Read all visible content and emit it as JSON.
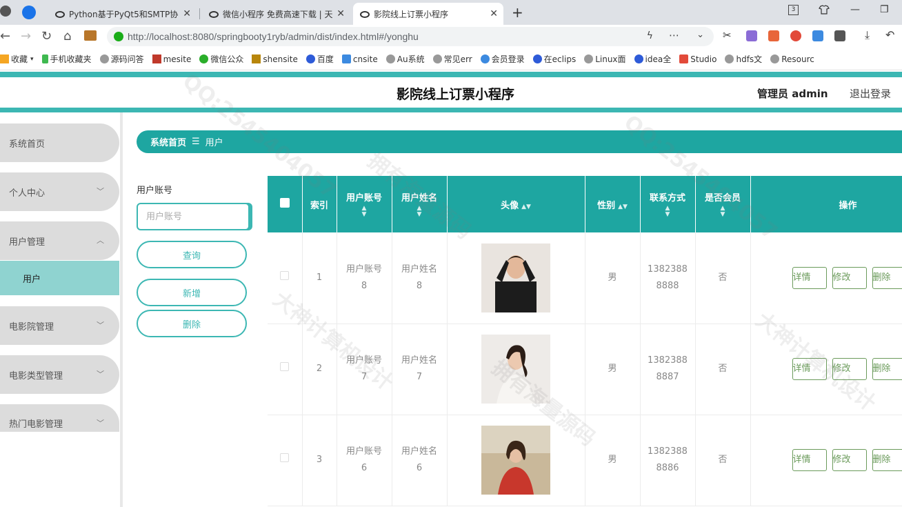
{
  "browser": {
    "tabs": [
      {
        "title": "Python基于PyQt5和SMTP协",
        "active": false
      },
      {
        "title": "微信小程序 免费高速下载 | 天",
        "active": false
      },
      {
        "title": "影院线上订票小程序",
        "active": true
      }
    ],
    "url": "http://localhost:8080/springbooty1ryb/admin/dist/index.html#/yonghu",
    "tab_count_badge": "3",
    "bookmarks": [
      "收藏",
      "手机收藏夹",
      "源码问答",
      "mesite",
      "微信公众",
      "shensite",
      "百度",
      "cnsite",
      "Au系统",
      "常见err",
      "会员登录",
      "在eclips",
      "Linux面",
      "idea全",
      "Studio",
      "hdfs文",
      "Resourc"
    ]
  },
  "header": {
    "title": "影院线上订票小程序",
    "admin": "管理员 admin",
    "logout": "退出登录"
  },
  "sidebar": {
    "items": [
      {
        "label": "系统首页",
        "chevron": false
      },
      {
        "label": "个人中心",
        "chevron": true
      },
      {
        "label": "用户管理",
        "chevron": true,
        "expanded": true
      },
      {
        "label": "电影院管理",
        "chevron": true
      },
      {
        "label": "电影类型管理",
        "chevron": true
      },
      {
        "label": "热门电影管理",
        "chevron": true
      }
    ],
    "sub_items": [
      {
        "label": "用户"
      }
    ]
  },
  "breadcrumb": {
    "home": "系统首页",
    "separator": "☰",
    "current": "用户"
  },
  "search": {
    "label": "用户账号",
    "placeholder": "用户账号",
    "query_btn": "查询",
    "add_btn": "新增",
    "delete_btn": "删除"
  },
  "table": {
    "columns": [
      "索引",
      "用户账号",
      "用户姓名",
      "头像",
      "性别",
      "联系方式",
      "是否会员",
      "操作"
    ],
    "rows": [
      {
        "index": "1",
        "account": "用户账号8",
        "name": "用户姓名8",
        "gender": "男",
        "phone": "13823888888",
        "member": "否"
      },
      {
        "index": "2",
        "account": "用户账号7",
        "name": "用户姓名7",
        "gender": "男",
        "phone": "13823888887",
        "member": "否"
      },
      {
        "index": "3",
        "account": "用户账号6",
        "name": "用户姓名6",
        "gender": "男",
        "phone": "13823888886",
        "member": "否"
      }
    ],
    "actions": [
      "详情",
      "修改",
      "删除"
    ]
  },
  "watermarks": [
    "QQ:2545404057",
    "拥有海量源码",
    "大神计算机设计"
  ],
  "colors": {
    "accent": "#1ea6a1",
    "stripe": "#3cb7b3",
    "sub_active": "#8fd3d0",
    "op_btn": "#6a9a5a"
  }
}
